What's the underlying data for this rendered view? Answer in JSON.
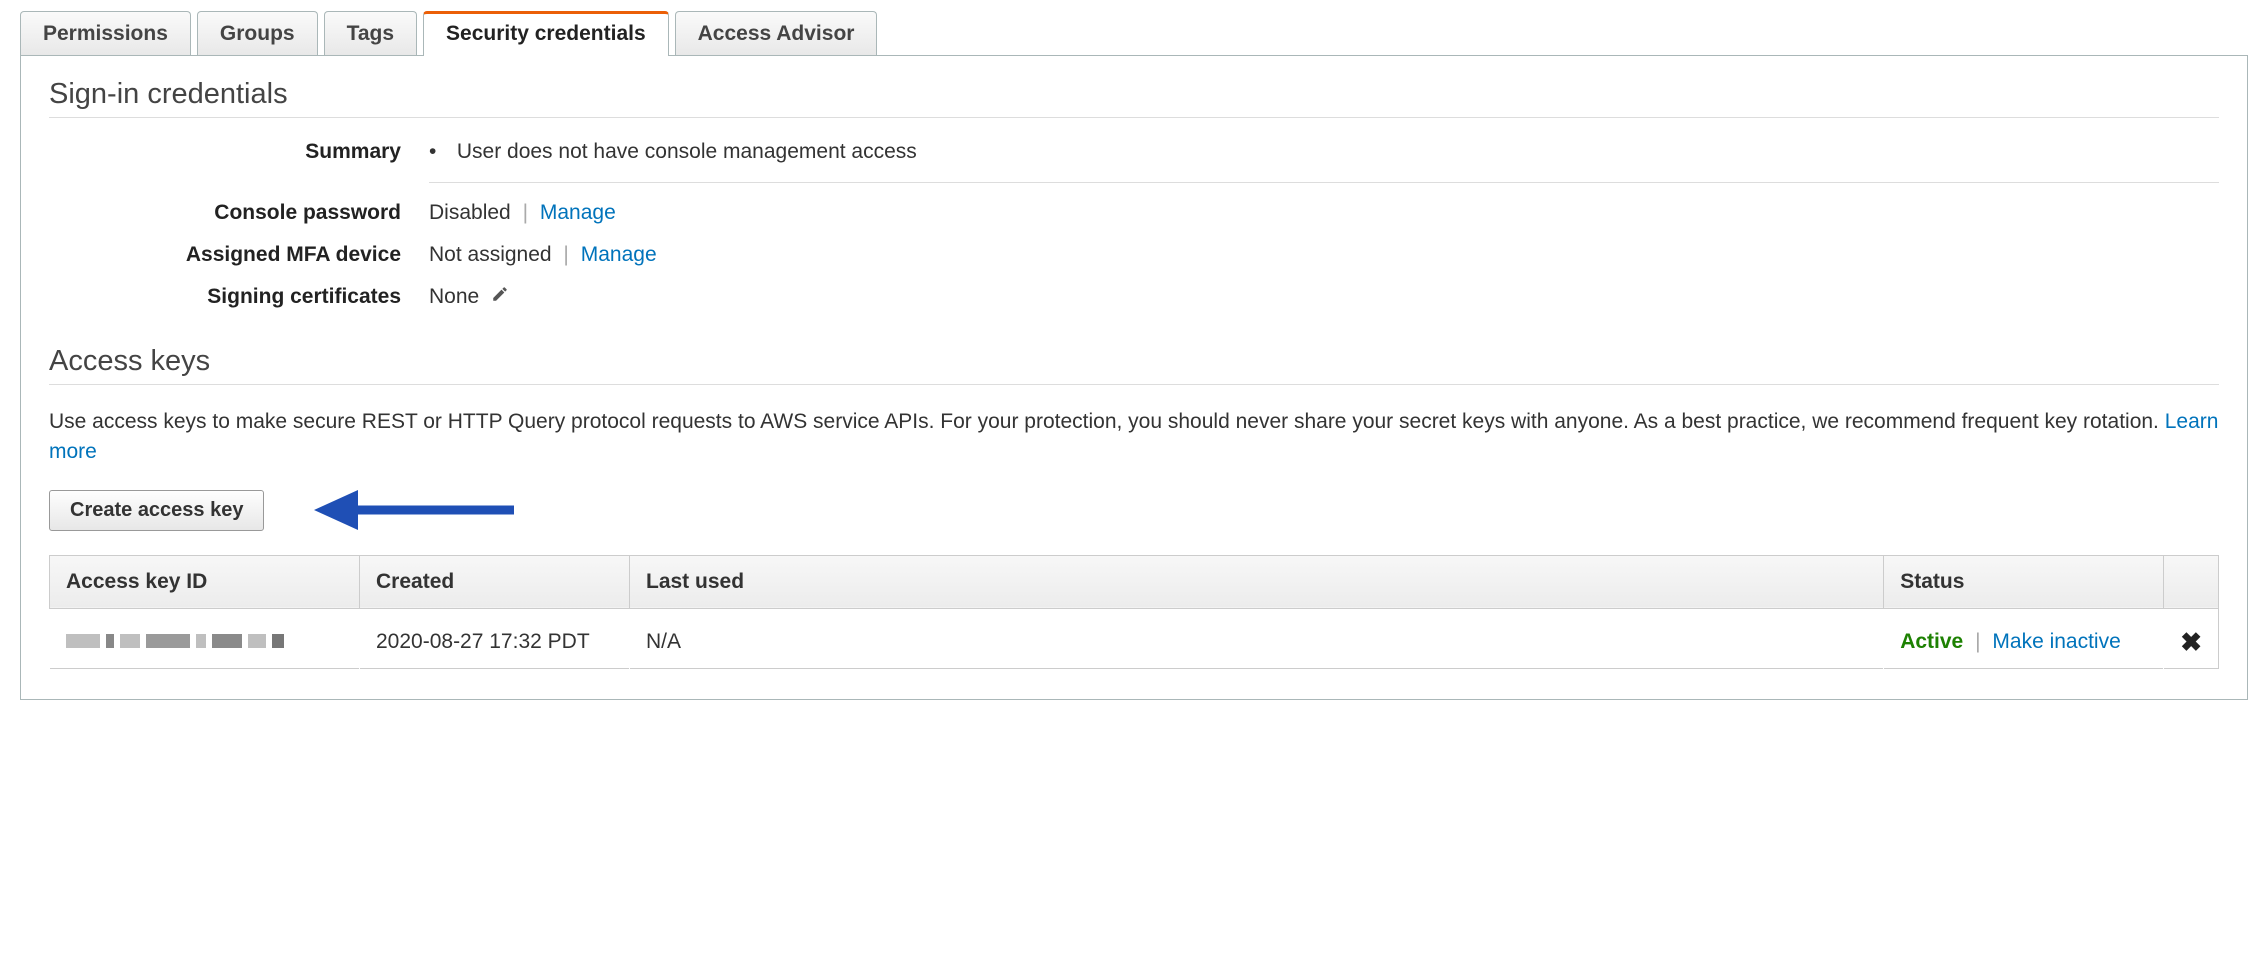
{
  "tabs": {
    "permissions": "Permissions",
    "groups": "Groups",
    "tags": "Tags",
    "security": "Security credentials",
    "advisor": "Access Advisor"
  },
  "signin": {
    "heading": "Sign-in credentials",
    "summary_label": "Summary",
    "summary_text": "User does not have console management access",
    "console_pw_label": "Console password",
    "console_pw_value": "Disabled",
    "mfa_label": "Assigned MFA device",
    "mfa_value": "Not assigned",
    "manage": "Manage",
    "signing_label": "Signing certificates",
    "signing_value": "None"
  },
  "access": {
    "heading": "Access keys",
    "description": "Use access keys to make secure REST or HTTP Query protocol requests to AWS service APIs. For your protection, you should never share your secret keys with anyone. As a best practice, we recommend frequent key rotation. ",
    "learn_more": "Learn more",
    "create_button": "Create access key",
    "columns": {
      "id": "Access key ID",
      "created": "Created",
      "last_used": "Last used",
      "status": "Status"
    },
    "rows": [
      {
        "created": "2020-08-27 17:32 PDT",
        "last_used": "N/A",
        "status": "Active",
        "inactive_link": "Make inactive"
      }
    ]
  }
}
